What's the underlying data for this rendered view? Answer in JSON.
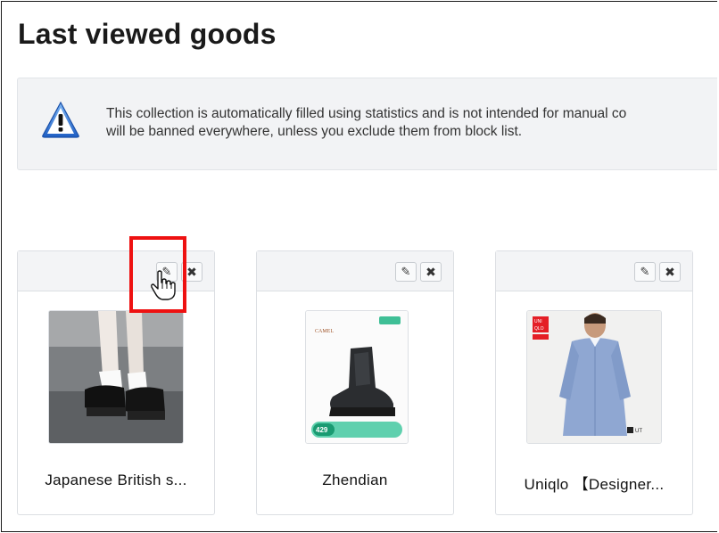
{
  "page": {
    "title": "Last viewed goods"
  },
  "notice": {
    "icon": "warning-triangle-icon",
    "line1": "This collection is automatically filled using statistics and is not intended for manual co",
    "line2": "will be banned everywhere, unless you exclude them from block list."
  },
  "cards": [
    {
      "name": "Japanese British s...",
      "edit_icon": "pencil-icon",
      "delete_icon": "close-icon",
      "delete_glyph": "✖",
      "edit_glyph": "✎",
      "image": "loafer-shoes-photo"
    },
    {
      "name": "Zhendian",
      "edit_icon": "pencil-icon",
      "delete_icon": "close-icon",
      "delete_glyph": "✖",
      "edit_glyph": "✎",
      "image": "hiking-boot-photo",
      "image_text": {
        "brand": "CAMEL",
        "price": "429"
      }
    },
    {
      "name": "Uniqlo 【Designer...",
      "edit_icon": "pencil-icon",
      "delete_icon": "close-icon",
      "delete_glyph": "✖",
      "edit_glyph": "✎",
      "image": "shirt-model-photo",
      "image_text": {
        "brand_top": "UNI",
        "brand_mid": "QLO",
        "brand_bot": "UT"
      }
    }
  ],
  "annotation": {
    "highlight_color": "#ee1111",
    "cursor": "hand-pointer-icon"
  },
  "colors": {
    "accent_blue": "#1f6fd1",
    "card_border": "#dcdfe3",
    "notice_bg": "#f2f3f5"
  }
}
